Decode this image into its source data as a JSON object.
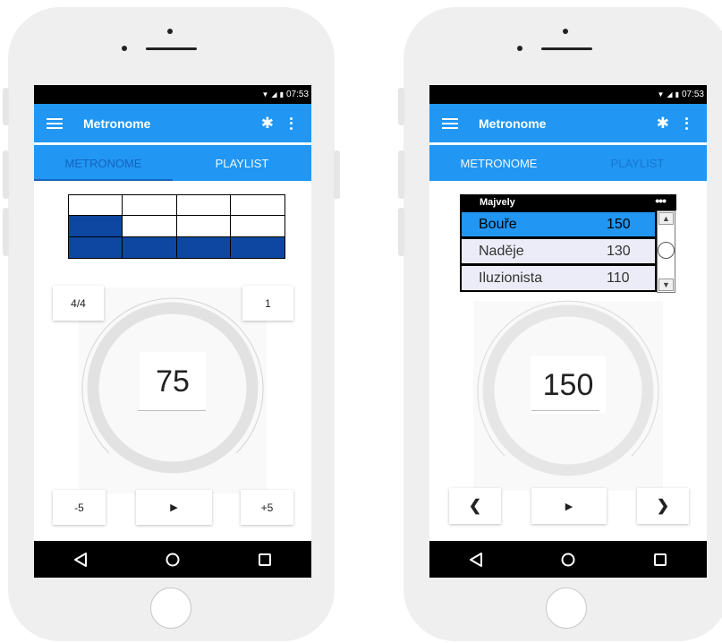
{
  "status_bar": {
    "time": "07:53"
  },
  "app_bar": {
    "title": "Metronome"
  },
  "tabs": [
    {
      "label": "METRONOME"
    },
    {
      "label": "PLAYLIST"
    }
  ],
  "metronome_screen": {
    "beat_grid": {
      "columns": 4,
      "rows": [
        [
          false,
          false,
          false,
          false
        ],
        [
          true,
          false,
          false,
          false
        ],
        [
          true,
          true,
          true,
          true
        ]
      ],
      "active_color": "#0d47a1"
    },
    "time_signature": "4/4",
    "subdivision": "1",
    "tempo": "75",
    "minus_label": "-5",
    "play_label": "▶",
    "plus_label": "+5"
  },
  "playlist_screen": {
    "playlist_name": "Majvely",
    "songs": [
      {
        "name": "Bouře",
        "tempo": "150",
        "selected": true
      },
      {
        "name": "Naděje",
        "tempo": "130",
        "selected": false
      },
      {
        "name": "Iluzionista",
        "tempo": "110",
        "selected": false
      }
    ],
    "tempo": "150",
    "prev_label": "❮",
    "play_label": "▶",
    "next_label": "❯"
  },
  "colors": {
    "app_bar": "#2196f3",
    "accent_dark": "#1565c0",
    "selected_row": "#2196f3"
  }
}
